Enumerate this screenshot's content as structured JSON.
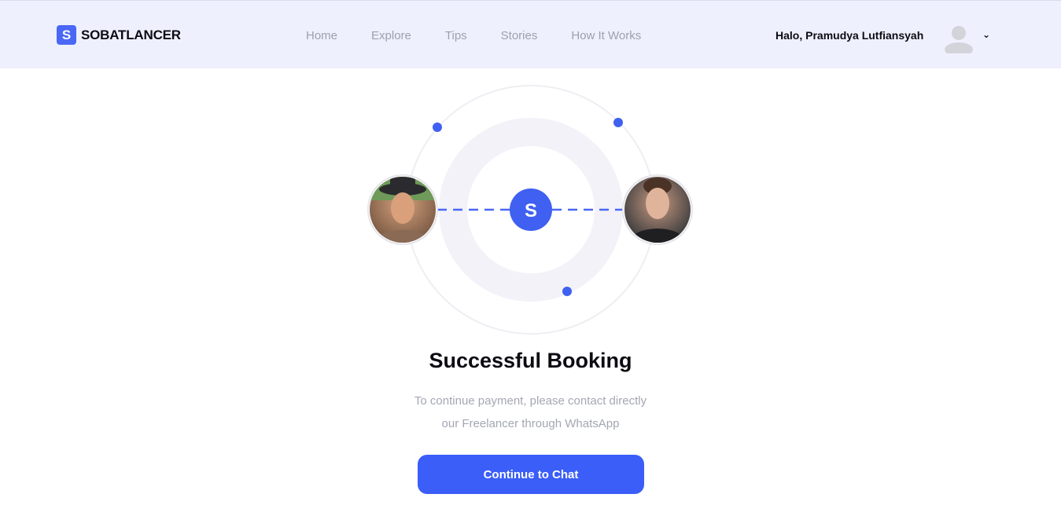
{
  "brand": {
    "name": "SOBATLANCER",
    "logo_letter": "S",
    "accent": "#4a67f5"
  },
  "nav": {
    "items": [
      {
        "label": "Home"
      },
      {
        "label": "Explore"
      },
      {
        "label": "Tips"
      },
      {
        "label": "Stories"
      },
      {
        "label": "How It Works"
      }
    ]
  },
  "user": {
    "greeting": "Halo, Pramudya Lutfiansyah"
  },
  "illustration": {
    "center_letter": "S"
  },
  "main": {
    "title": "Successful Booking",
    "subtitle_line1": "To continue payment, please contact directly",
    "subtitle_line2": "our Freelancer through WhatsApp",
    "cta_label": "Continue to Chat"
  },
  "colors": {
    "nav_bg": "#eef0fd",
    "primary": "#3b5ef8",
    "muted_text": "#a4a7b3"
  }
}
